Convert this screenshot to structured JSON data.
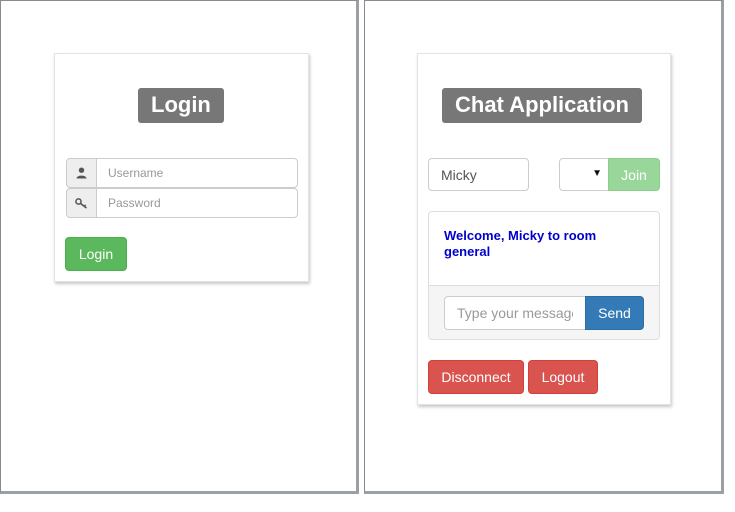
{
  "login": {
    "title": "Login",
    "username_placeholder": "Username",
    "password_placeholder": "Password",
    "username_icon": "user-icon",
    "password_icon": "key-icon",
    "login_button": "Login"
  },
  "chat": {
    "title": "Chat Application",
    "name_value": "Micky",
    "room_selected": "",
    "join_button": "Join",
    "welcome_message": "Welcome, Micky to room general",
    "message_placeholder": "Type your message",
    "send_button": "Send",
    "disconnect_button": "Disconnect",
    "logout_button": "Logout"
  },
  "colors": {
    "title_badge": "#777777",
    "success": "#5cb85c",
    "join_disabled": "#99d699",
    "primary": "#337ab7",
    "danger": "#d9534f",
    "welcome_text": "#0000cc"
  }
}
